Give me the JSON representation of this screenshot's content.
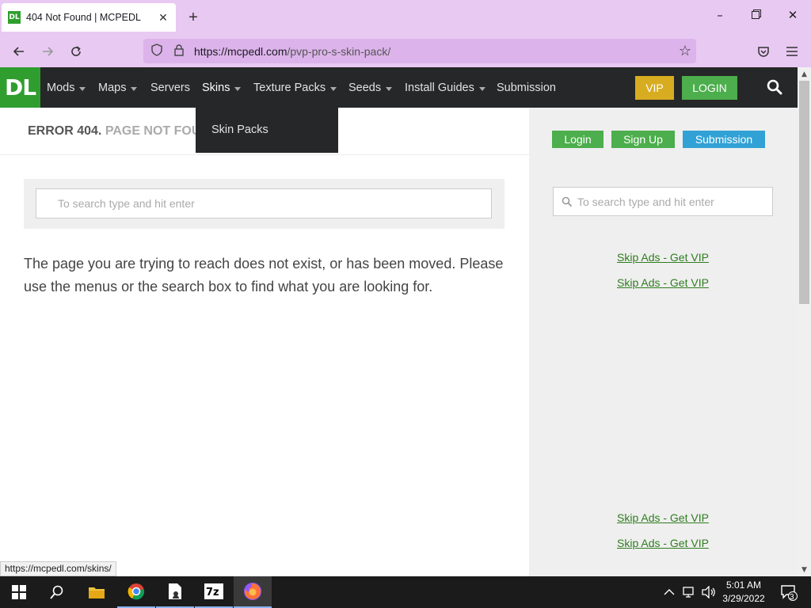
{
  "browser": {
    "tab_title": "404 Not Found | MCPEDL",
    "favicon_text": "DL",
    "url_domain": "https://mcpedl.com",
    "url_path": "/pvp-pro-s-skin-pack/",
    "status_url": "https://mcpedl.com/skins/"
  },
  "site": {
    "logo": "DL",
    "menu": [
      {
        "label": "Mods"
      },
      {
        "label": "Maps"
      },
      {
        "label": "Servers"
      },
      {
        "label": "Skins"
      },
      {
        "label": "Texture Packs"
      },
      {
        "label": "Seeds"
      },
      {
        "label": "Install Guides"
      },
      {
        "label": "Submission"
      }
    ],
    "vip_label": "VIP",
    "login_label": "LOGIN",
    "dropdown_item": "Skin Packs"
  },
  "main": {
    "error_code": "ERROR 404.",
    "error_text": "PAGE NOT FOU",
    "search_placeholder": "To search type and hit enter",
    "message": "The page you are trying to reach does not exist, or has been moved. Please use the menus or the search box to find what you are looking for."
  },
  "sidebar": {
    "login": "Login",
    "signup": "Sign Up",
    "submission": "Submission",
    "search_placeholder": "To search type and hit enter",
    "skip_ads": [
      "Skip Ads - Get VIP",
      "Skip Ads - Get VIP",
      "Skip Ads - Get VIP",
      "Skip Ads - Get VIP"
    ]
  },
  "taskbar": {
    "time": "5:01 AM",
    "date": "3/29/2022",
    "notification_count": "3"
  },
  "colors": {
    "chrome": "#e8c9f2",
    "header": "#262729",
    "brand_green": "#2f9e2f",
    "vip": "#d8ac21",
    "submission": "#31a1d6"
  }
}
